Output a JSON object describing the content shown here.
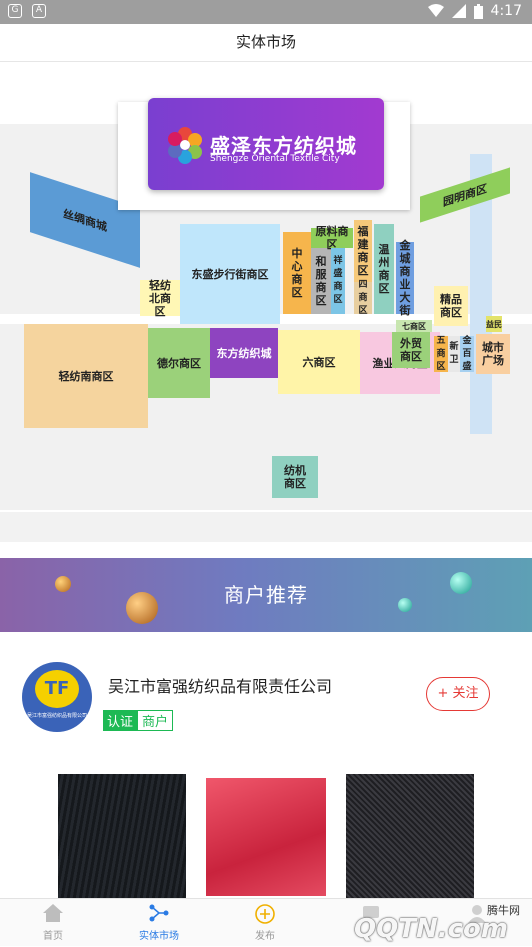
{
  "status": {
    "left_icons": [
      "car-mode-icon",
      "notification-icon"
    ],
    "time": "4:17"
  },
  "header": {
    "title": "实体市场"
  },
  "map": {
    "logo": {
      "cn": "盛泽东方纺织城",
      "en": "Shengze Oriental Textile City"
    },
    "zones": [
      {
        "id": "sichou",
        "label": "丝绸商城",
        "color": "#5b9bd5"
      },
      {
        "id": "dongsheng",
        "label": "东盛步行街商区",
        "color": "#bfe6fb"
      },
      {
        "id": "qingfangbei",
        "label": "轻纺北商区",
        "color": "#fff7b5"
      },
      {
        "id": "zhongxin",
        "label": "中心商区",
        "color": "#f6b54c"
      },
      {
        "id": "hefu",
        "label": "和服商区",
        "color": "#b5b5b5"
      },
      {
        "id": "yuanliao",
        "label": "原料商区",
        "color": "#8fce5b"
      },
      {
        "id": "xiangsheng",
        "label": "祥盛商区",
        "color": "#7cc5e6"
      },
      {
        "id": "fujian",
        "label": "福建商区",
        "color": "#f6c97a"
      },
      {
        "id": "sibian",
        "label": "四商区",
        "color": "#e8cfa0"
      },
      {
        "id": "wenzhou",
        "label": "温州商区",
        "color": "#8fd0c0"
      },
      {
        "id": "jincheng",
        "label": "金城商业大街",
        "color": "#6f9ee0"
      },
      {
        "id": "yuanming",
        "label": "园明商区",
        "color": "#8fce5b"
      },
      {
        "id": "jingpin",
        "label": "精品商区",
        "color": "#fff1b0"
      },
      {
        "id": "qishang",
        "label": "七商区",
        "color": "#c8e6b0"
      },
      {
        "id": "yilu",
        "label": "益民",
        "color": "#e3e36a"
      },
      {
        "id": "chengshi",
        "label": "城市广场",
        "color": "#f9cfa0"
      },
      {
        "id": "qingfangnan",
        "label": "轻纺南商区",
        "color": "#f5d49e"
      },
      {
        "id": "deer",
        "label": "德尔商区",
        "color": "#9bd17a"
      },
      {
        "id": "dongfang",
        "label": "东方纺织城",
        "color": "#8e44c0"
      },
      {
        "id": "liushang",
        "label": "六商区",
        "color": "#fff4a8"
      },
      {
        "id": "yuyeba",
        "label": "渔业八商区",
        "color": "#f8c8e0"
      },
      {
        "id": "waimao",
        "label": "外贸商区",
        "color": "#9bd17a"
      },
      {
        "id": "wushang",
        "label": "五商区",
        "color": "#f6b54c"
      },
      {
        "id": "xinwei",
        "label": "新卫",
        "color": "#e8e8e8"
      },
      {
        "id": "jinbaisheng",
        "label": "金百盛",
        "color": "#a6d0f0"
      },
      {
        "id": "fangji",
        "label": "纺机商区",
        "color": "#8fd0c0"
      }
    ]
  },
  "banner": {
    "title": "商户推荐"
  },
  "merchant": {
    "name": "吴江市富强纺织品有限责任公司",
    "avatar_caption": "吴江市富强纺织品有限公司",
    "tags": [
      "认证",
      "商户"
    ],
    "follow_label": "+ 关注"
  },
  "products": [
    {
      "name": "black-fabric",
      "color": "#1c1f24"
    },
    {
      "name": "red-fabric",
      "color": "#d9304a"
    },
    {
      "name": "dark-fabric",
      "color": "#2a2a2e"
    }
  ],
  "tabs": [
    {
      "label": "首页",
      "icon": "home-icon",
      "active": false
    },
    {
      "label": "实体市场",
      "icon": "market-icon",
      "active": true
    },
    {
      "label": "发布",
      "icon": "publish-icon",
      "active": false
    },
    {
      "label": "",
      "icon": "message-icon",
      "active": false
    },
    {
      "label": "",
      "icon": "profile-icon",
      "active": false
    }
  ],
  "watermark": {
    "text": "QQTN.com",
    "sub": "腾牛网"
  },
  "colors": {
    "accent": "#2a7be4",
    "follow": "#e53935",
    "tag": "#1db954"
  }
}
